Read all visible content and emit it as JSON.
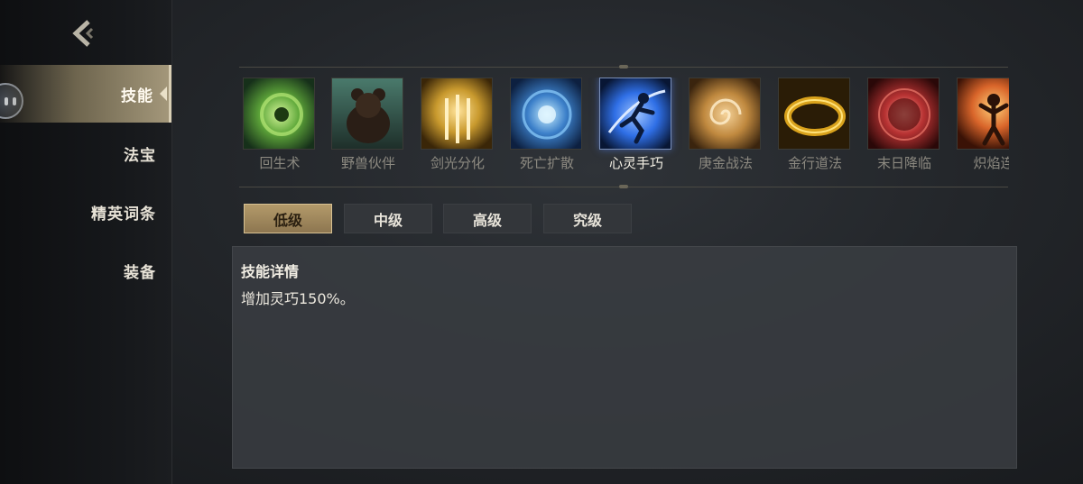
{
  "sidebar": {
    "back_icon": "chevron-left-icon",
    "items": [
      {
        "label": "技能",
        "active": true
      },
      {
        "label": "法宝",
        "active": false
      },
      {
        "label": "精英词条",
        "active": false
      },
      {
        "label": "装备",
        "active": false
      }
    ]
  },
  "skills": [
    {
      "name": "回生术",
      "icon": "green-vortex-icon",
      "color": "#5fa83a"
    },
    {
      "name": "野兽伙伴",
      "icon": "bear-icon",
      "color": "#3f6e60"
    },
    {
      "name": "剑光分化",
      "icon": "golden-swords-icon",
      "color": "#c99a2e"
    },
    {
      "name": "死亡扩散",
      "icon": "blue-burst-icon",
      "color": "#3b7fc9"
    },
    {
      "name": "心灵手巧",
      "icon": "leaping-figure-icon",
      "color": "#2f6fe6",
      "selected": true
    },
    {
      "name": "庚金战法",
      "icon": "golden-swirl-icon",
      "color": "#c0893f"
    },
    {
      "name": "金行道法",
      "icon": "golden-ring-icon",
      "color": "#d9a21c"
    },
    {
      "name": "末日降临",
      "icon": "red-explosion-icon",
      "color": "#b73232"
    },
    {
      "name": "炽焰连",
      "icon": "fire-warrior-icon",
      "color": "#d9652a"
    }
  ],
  "tabs": [
    {
      "label": "低级",
      "active": true
    },
    {
      "label": "中级",
      "active": false
    },
    {
      "label": "高级",
      "active": false
    },
    {
      "label": "究级",
      "active": false
    }
  ],
  "detail": {
    "title": "技能详情",
    "text": "增加灵巧150%。"
  },
  "colors": {
    "accent_gold": "#b39a6a",
    "selected_blue": "#2f6fe6"
  }
}
